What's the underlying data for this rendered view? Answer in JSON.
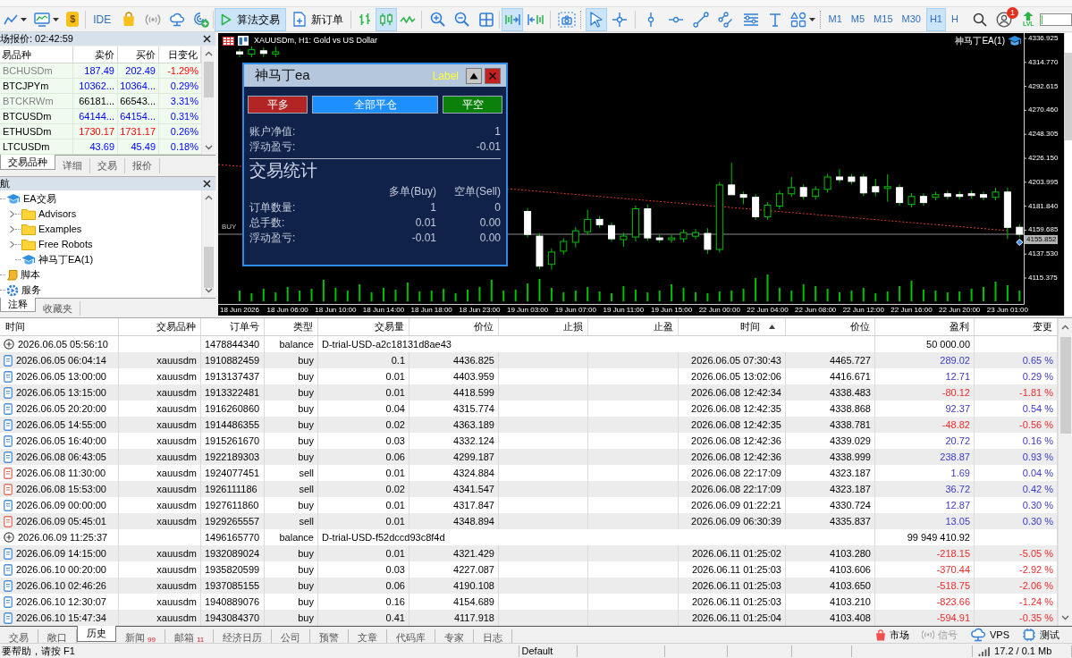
{
  "toolbar": {
    "deposit": "$",
    "ide": "IDE",
    "algo_trading": {
      "label": "算法交易",
      "on": true
    },
    "new_order": "新订单",
    "chart_types": [
      {
        "kind": "bars",
        "selected": false
      },
      {
        "kind": "candles",
        "selected": true
      },
      {
        "kind": "line",
        "selected": false
      }
    ],
    "auto_scroll": true,
    "chart_shift": false,
    "pointer_tools": [
      {
        "kind": "cursor",
        "selected": true
      },
      {
        "kind": "crosshair",
        "selected": false
      }
    ],
    "timeframes": [
      {
        "label": "M1",
        "selected": false
      },
      {
        "label": "M5",
        "selected": false
      },
      {
        "label": "M15",
        "selected": false
      },
      {
        "label": "M30",
        "selected": false
      },
      {
        "label": "H1",
        "selected": true
      },
      {
        "label": "H",
        "selected": false
      }
    ],
    "notification_count": "1",
    "level_badge": "LVL",
    "progress": {
      "level": 0.05
    }
  },
  "market_watch": {
    "title": "场报价: 02:42:59",
    "columns": [
      "易品种",
      "卖价",
      "买价",
      "日变化"
    ],
    "rows": [
      {
        "symbol": "BCHUSDm",
        "bid": "187.49",
        "ask": "202.49",
        "change": "-1.29%",
        "kind": "up",
        "dimmed": true,
        "falling": true
      },
      {
        "symbol": "BTCJPYm",
        "bid": "10362...",
        "ask": "10364...",
        "change": "0.29%",
        "kind": "up",
        "dimmed": false,
        "falling": false
      },
      {
        "symbol": "BTCKRWm",
        "bid": "66181...",
        "ask": "66543...",
        "change": "3.31%",
        "kind": "flat",
        "dimmed": true,
        "falling": false
      },
      {
        "symbol": "BTCUSDm",
        "bid": "64144...",
        "ask": "64154...",
        "change": "0.31%",
        "kind": "up",
        "dimmed": false,
        "falling": false
      },
      {
        "symbol": "ETHUSDm",
        "bid": "1730.17",
        "ask": "1731.17",
        "change": "0.26%",
        "kind": "down",
        "dimmed": false,
        "falling": false
      },
      {
        "symbol": "LTCUSDm",
        "bid": "43.69",
        "ask": "45.49",
        "change": "0.18%",
        "kind": "up",
        "dimmed": false,
        "falling": false
      }
    ],
    "tabs": [
      {
        "label": "交易品种",
        "selected": true
      },
      {
        "label": "详细",
        "selected": false
      },
      {
        "label": "交易",
        "selected": false
      },
      {
        "label": "报价",
        "selected": false
      }
    ]
  },
  "navigator": {
    "title": "航",
    "tree": [
      {
        "label": "EA交易",
        "kind": "experts",
        "children": [
          {
            "label": "Advisors",
            "kind": "folder",
            "expanded": false
          },
          {
            "label": "Examples",
            "kind": "folder",
            "expanded": false
          },
          {
            "label": "Free Robots",
            "kind": "folder",
            "expanded": false
          },
          {
            "label": "神马丁EA(1)",
            "kind": "expert"
          }
        ]
      },
      {
        "label": "脚本",
        "kind": "scripts"
      },
      {
        "label": "服务",
        "kind": "services"
      }
    ],
    "tabs": [
      {
        "label": "注释",
        "selected": true
      },
      {
        "label": "收藏夹",
        "selected": false
      }
    ]
  },
  "chart": {
    "title": "XAUUSDm, H1: Gold vs US Dollar",
    "expert": "神马丁EA(1)",
    "order_label": "BUY",
    "chart_data": {
      "type": "candlestick",
      "categories": [
        "18 Jun 2026",
        null,
        null,
        null,
        "18 Jun 06:00",
        null,
        null,
        null,
        "18 Jun 10:00",
        null,
        null,
        null,
        "18 Jun 14:00",
        null,
        null,
        null,
        "18 Jun 18:00",
        null,
        null,
        null,
        "18 Jun 23:00",
        null,
        null,
        null,
        "19 Jun 03:00",
        null,
        null,
        null,
        "19 Jun 07:00",
        null,
        null,
        null,
        "19 Jun 11:00",
        null,
        null,
        null,
        "19 Jun 15:00",
        null,
        null,
        null,
        "22 Jun 00:00",
        null,
        null,
        null,
        "22 Jun 04:00",
        null,
        null,
        null,
        "22 Jun 08:00",
        null,
        null,
        null,
        "22 Jun 12:00",
        null,
        null,
        null,
        "22 Jun 16:00",
        null,
        null,
        null,
        "22 Jun 20:00",
        null,
        null,
        null,
        "23 Jun 01:00",
        null
      ],
      "ohlc": [
        [
          4324.5,
          4327.3,
          4319.7,
          4322.5
        ],
        [
          4322.4,
          4329.5,
          4319.7,
          4326.5
        ],
        [
          4325.5,
          4328.5,
          4319.8,
          4323.0
        ],
        [
          4322.5,
          4329.5,
          4319.7,
          4324.5
        ],
        null,
        null,
        null,
        null,
        null,
        null,
        null,
        null,
        null,
        null,
        null,
        null,
        null,
        null,
        null,
        null,
        null,
        null,
        null,
        null,
        [
          4176.99,
          4180.0,
          4152.9,
          4155.77
        ],
        [
          4154.14,
          4156.9,
          4123.5,
          4126.4
        ],
        [
          4128.03,
          4142.72,
          4123.13,
          4139.45
        ],
        [
          4140.27,
          4152.3,
          4137.01,
          4149.25
        ],
        [
          4148.43,
          4162.3,
          4143.53,
          4159.04
        ],
        [
          4158.22,
          4178.62,
          4155.3,
          4169.65
        ],
        [
          4169.65,
          4172.5,
          4161.9,
          4164.75
        ],
        [
          4163.93,
          4166.8,
          4148.9,
          4151.69
        ],
        [
          4150.88,
          4157.41,
          4144.35,
          4154.14
        ],
        [
          4153.33,
          4182.3,
          4149.25,
          4179.44
        ],
        [
          4179.44,
          4183.52,
          4149.6,
          4152.51
        ],
        [
          4152.51,
          4155.4,
          4148.0,
          4150.88
        ],
        [
          4150.88,
          4155.4,
          4148.0,
          4152.51
        ],
        [
          4151.69,
          4160.3,
          4148.43,
          4157.41
        ],
        [
          4154.14,
          4160.67,
          4151.2,
          4157.41
        ],
        [
          4156.59,
          4161.49,
          4137.82,
          4141.9
        ],
        [
          4141.9,
          4204.3,
          4139.0,
          4201.47
        ],
        [
          4201.47,
          4221.87,
          4192.49,
          4192.49
        ],
        [
          4192.49,
          4195.3,
          4183.52,
          4190.05
        ],
        [
          4190.05,
          4193.0,
          4169.2,
          4172.09
        ],
        [
          4172.09,
          4185.6,
          4169.2,
          4182.7
        ],
        [
          4181.89,
          4196.2,
          4179.0,
          4193.31
        ],
        [
          4193.31,
          4208.81,
          4190.3,
          4199.02
        ],
        [
          4199.02,
          4201.9,
          4188.0,
          4190.86
        ],
        [
          4190.86,
          4200.2,
          4188.0,
          4197.39
        ],
        [
          4197.39,
          4211.7,
          4194.5,
          4208.81
        ],
        [
          4208.81,
          4216.16,
          4203.4,
          4206.37
        ],
        [
          4208.81,
          4211.6,
          4201.9,
          4204.73
        ],
        [
          4208.81,
          4211.6,
          4191.3,
          4194.13
        ],
        [
          4199.84,
          4207.18,
          4190.86,
          4194.94
        ],
        [
          4198.21,
          4211.26,
          4185.97,
          4199.84
        ],
        [
          4199.02,
          4201.9,
          4182.3,
          4185.15
        ],
        [
          4183.52,
          4193.8,
          4180.7,
          4190.86
        ],
        [
          4190.86,
          4193.8,
          4182.3,
          4185.15
        ],
        [
          4190.05,
          4195.3,
          4187.2,
          4192.49
        ],
        [
          4193.31,
          4196.1,
          4188.0,
          4190.86
        ],
        [
          4192.49,
          4195.4,
          4188.0,
          4190.86
        ],
        [
          4193.31,
          4196.2,
          4188.9,
          4191.68
        ],
        [
          4192.49,
          4195.3,
          4187.2,
          4190.05
        ],
        [
          4190.05,
          4199.02,
          4187.2,
          4194.94
        ],
        [
          4194.94,
          4199.02,
          4151.69,
          4162.3
        ],
        [
          4162.3,
          4165.1,
          4153.0,
          4155.85
        ]
      ],
      "ylim": [
        4091.4,
        4341.9
      ],
      "yticks": [
        {
          "value": 4336.925,
          "label": "4336.925"
        },
        {
          "value": 4314.77,
          "label": "4314.770"
        },
        {
          "value": 4292.615,
          "label": "4292.615"
        },
        {
          "value": 4270.46,
          "label": "4270.460"
        },
        {
          "value": 4248.305,
          "label": "4248.305"
        },
        {
          "value": 4226.15,
          "label": "4226.150"
        },
        {
          "value": 4203.995,
          "label": "4203.995"
        },
        {
          "value": 4181.84,
          "label": "4181.840"
        },
        {
          "value": 4159.685,
          "label": "4159.685"
        },
        {
          "value": 4137.53,
          "label": "4137.530"
        },
        {
          "value": 4115.375,
          "label": "4115.375"
        }
      ],
      "ref_lines": [
        {
          "axis": "y",
          "value": 4155.852,
          "label": "4155.852"
        }
      ]
    }
  },
  "ea_panel": {
    "title": "神马丁ea",
    "label": "Label",
    "buttons": [
      {
        "label": "平多",
        "kind": "close_buy"
      },
      {
        "label": "全部平仓",
        "kind": "close_all"
      },
      {
        "label": "平空",
        "kind": "close_sell"
      }
    ],
    "account": [
      {
        "label": "账户净值:",
        "value": "1"
      },
      {
        "label": "浮动盈亏:",
        "value": "-0.01"
      }
    ],
    "stats_title": "交易统计",
    "stats_columns": [
      "多单(Buy)",
      "空单(Sell)"
    ],
    "stats_rows": [
      {
        "label": "订单数量:",
        "buy": "1",
        "sell": "0"
      },
      {
        "label": "总手数:",
        "buy": "0.01",
        "sell": "0.00"
      },
      {
        "label": "浮动盈亏:",
        "buy": "-0.01",
        "sell": "0.00"
      }
    ]
  },
  "history": {
    "columns": [
      {
        "label": "时间",
        "sorted": false
      },
      {
        "label": "交易品种",
        "sorted": false
      },
      {
        "label": "订单号",
        "sorted": false
      },
      {
        "label": "类型",
        "sorted": false
      },
      {
        "label": "交易量",
        "sorted": false
      },
      {
        "label": "价位",
        "sorted": false
      },
      {
        "label": "止损",
        "sorted": false
      },
      {
        "label": "止盈",
        "sorted": false
      },
      {
        "label": "时间",
        "sorted": true
      },
      {
        "label": "价位",
        "sorted": false
      },
      {
        "label": "盈利",
        "sorted": false
      },
      {
        "label": "变更",
        "sorted": false
      }
    ],
    "rows": [
      {
        "kind": "balance",
        "time": "2026.06.05 05:56:10",
        "order": "1478844340",
        "type": "balance",
        "comment": "D-trial-USD-a2c18131d8ae43",
        "profit": "50 000.00"
      },
      {
        "kind": "buy",
        "time": "2026.06.05 06:04:14",
        "symbol": "xauusdm",
        "order": "1910882459",
        "type": "buy",
        "volume": "0.1",
        "price": "4436.825",
        "close_time": "2026.06.05 07:30:43",
        "close_price": "4465.727",
        "profit": "289.02",
        "change": "0.65 %",
        "loss": false
      },
      {
        "kind": "buy",
        "time": "2026.06.05 13:00:00",
        "symbol": "xauusdm",
        "order": "1913137437",
        "type": "buy",
        "volume": "0.01",
        "price": "4403.959",
        "close_time": "2026.06.05 13:02:06",
        "close_price": "4416.671",
        "profit": "12.71",
        "change": "0.29 %",
        "loss": false
      },
      {
        "kind": "buy",
        "time": "2026.06.05 13:15:00",
        "symbol": "xauusdm",
        "order": "1913322481",
        "type": "buy",
        "volume": "0.01",
        "price": "4418.599",
        "close_time": "2026.06.08 12:42:34",
        "close_price": "4338.483",
        "profit": "-80.12",
        "change": "-1.81 %",
        "loss": true
      },
      {
        "kind": "buy",
        "time": "2026.06.05 20:20:00",
        "symbol": "xauusdm",
        "order": "1916260860",
        "type": "buy",
        "volume": "0.04",
        "price": "4315.774",
        "close_time": "2026.06.08 12:42:35",
        "close_price": "4338.868",
        "profit": "92.37",
        "change": "0.54 %",
        "loss": false
      },
      {
        "kind": "buy",
        "time": "2026.06.05 14:55:00",
        "symbol": "xauusdm",
        "order": "1914486355",
        "type": "buy",
        "volume": "0.02",
        "price": "4363.189",
        "close_time": "2026.06.08 12:42:35",
        "close_price": "4338.781",
        "profit": "-48.82",
        "change": "-0.56 %",
        "loss": true
      },
      {
        "kind": "buy",
        "time": "2026.06.05 16:40:00",
        "symbol": "xauusdm",
        "order": "1915261670",
        "type": "buy",
        "volume": "0.03",
        "price": "4332.124",
        "close_time": "2026.06.08 12:42:36",
        "close_price": "4339.029",
        "profit": "20.72",
        "change": "0.16 %",
        "loss": false
      },
      {
        "kind": "buy",
        "time": "2026.06.08 06:43:05",
        "symbol": "xauusdm",
        "order": "1922189303",
        "type": "buy",
        "volume": "0.06",
        "price": "4299.187",
        "close_time": "2026.06.08 12:42:36",
        "close_price": "4338.999",
        "profit": "238.87",
        "change": "0.93 %",
        "loss": false
      },
      {
        "kind": "sell",
        "time": "2026.06.08 11:30:00",
        "symbol": "xauusdm",
        "order": "1924077451",
        "type": "sell",
        "volume": "0.01",
        "price": "4324.884",
        "close_time": "2026.06.08 22:17:09",
        "close_price": "4323.187",
        "profit": "1.69",
        "change": "0.04 %",
        "loss": false
      },
      {
        "kind": "sell",
        "time": "2026.06.08 15:53:00",
        "symbol": "xauusdm",
        "order": "1926111186",
        "type": "sell",
        "volume": "0.02",
        "price": "4341.547",
        "close_time": "2026.06.08 22:17:09",
        "close_price": "4323.187",
        "profit": "36.72",
        "change": "0.42 %",
        "loss": false
      },
      {
        "kind": "buy",
        "time": "2026.06.09 00:00:00",
        "symbol": "xauusdm",
        "order": "1927611860",
        "type": "buy",
        "volume": "0.01",
        "price": "4317.847",
        "close_time": "2026.06.09 01:22:21",
        "close_price": "4330.724",
        "profit": "12.87",
        "change": "0.30 %",
        "loss": false
      },
      {
        "kind": "sell",
        "time": "2026.06.09 05:45:01",
        "symbol": "xauusdm",
        "order": "1929265557",
        "type": "sell",
        "volume": "0.01",
        "price": "4348.894",
        "close_time": "2026.06.09 06:30:39",
        "close_price": "4335.837",
        "profit": "13.05",
        "change": "0.30 %",
        "loss": false
      },
      {
        "kind": "balance",
        "time": "2026.06.09 11:25:37",
        "order": "1496165770",
        "type": "balance",
        "comment": "D-trial-USD-f52dccd93c8f4d",
        "profit": "99 949 410.92"
      },
      {
        "kind": "buy",
        "time": "2026.06.09 14:15:00",
        "symbol": "xauusdm",
        "order": "1932089024",
        "type": "buy",
        "volume": "0.01",
        "price": "4321.429",
        "close_time": "2026.06.11 01:25:02",
        "close_price": "4103.280",
        "profit": "-218.15",
        "change": "-5.05 %",
        "loss": true
      },
      {
        "kind": "buy",
        "time": "2026.06.10 00:20:00",
        "symbol": "xauusdm",
        "order": "1935820599",
        "type": "buy",
        "volume": "0.03",
        "price": "4227.087",
        "close_time": "2026.06.11 01:25:03",
        "close_price": "4103.606",
        "profit": "-370.44",
        "change": "-2.92 %",
        "loss": true
      },
      {
        "kind": "buy",
        "time": "2026.06.10 02:46:26",
        "symbol": "xauusdm",
        "order": "1937085155",
        "type": "buy",
        "volume": "0.06",
        "price": "4190.108",
        "close_time": "2026.06.11 01:25:03",
        "close_price": "4103.650",
        "profit": "-518.75",
        "change": "-2.06 %",
        "loss": true
      },
      {
        "kind": "buy",
        "time": "2026.06.10 12:30:07",
        "symbol": "xauusdm",
        "order": "1940889076",
        "type": "buy",
        "volume": "0.16",
        "price": "4154.689",
        "close_time": "2026.06.11 01:25:03",
        "close_price": "4103.210",
        "profit": "-823.66",
        "change": "-1.24 %",
        "loss": true
      },
      {
        "kind": "buy",
        "time": "2026.06.10 15:47:34",
        "symbol": "xauusdm",
        "order": "1943084370",
        "type": "buy",
        "volume": "0.41",
        "price": "4117.918",
        "close_time": "2026.06.11 01:25:04",
        "close_price": "4103.408",
        "profit": "-594.91",
        "change": "-0.35 %",
        "loss": true
      }
    ]
  },
  "toolbox_tabs": [
    {
      "label": "交易",
      "selected": false
    },
    {
      "label": "敞口",
      "selected": false
    },
    {
      "label": "历史",
      "selected": true
    },
    {
      "label": "新闻",
      "badge": "99",
      "selected": false
    },
    {
      "label": "邮箱",
      "badge": "11",
      "selected": false
    },
    {
      "label": "经济日历",
      "selected": false
    },
    {
      "label": "公司",
      "selected": false
    },
    {
      "label": "预警",
      "selected": false
    },
    {
      "label": "文章",
      "selected": false
    },
    {
      "label": "代码库",
      "selected": false
    },
    {
      "label": "专家",
      "selected": false
    },
    {
      "label": "日志",
      "selected": false
    }
  ],
  "services": [
    {
      "label": "市场",
      "kind": "market"
    },
    {
      "label": "信号",
      "kind": "signals"
    },
    {
      "label": "VPS",
      "kind": "vps"
    },
    {
      "label": "测试",
      "kind": "tester"
    }
  ],
  "status_bar": {
    "help": "要帮助，请按 F1",
    "profile": "Default",
    "traffic": "17.2 / 0.1 Mb"
  }
}
